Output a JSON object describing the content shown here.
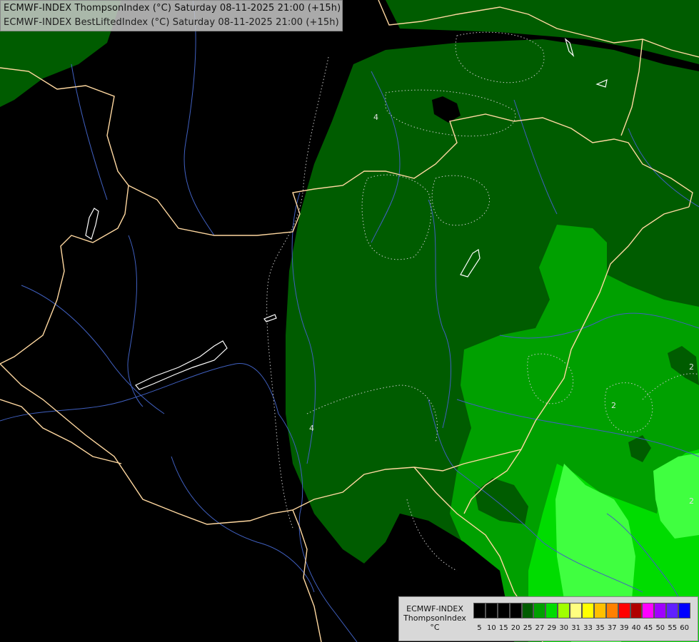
{
  "header": {
    "line1": "ECMWF-INDEX ThompsonIndex (°C) Saturday 08-11-2025 21:00 (+15h)",
    "line2": "ECMWF-INDEX BestLiftedIndex (°C) Saturday 08-11-2025 21:00 (+15h)"
  },
  "legend": {
    "title_line1": "ECMWF-INDEX",
    "title_line2": "ThompsonIndex",
    "title_line3": "°C",
    "values": [
      "5",
      "10",
      "15",
      "20",
      "25",
      "27",
      "29",
      "30",
      "31",
      "33",
      "35",
      "37",
      "39",
      "40",
      "45",
      "50",
      "55",
      "60"
    ],
    "colors": [
      "#000000",
      "#000000",
      "#000000",
      "#000000",
      "#005c00",
      "#00a000",
      "#00dc00",
      "#a0ff00",
      "#ffff80",
      "#ffff00",
      "#ffc000",
      "#ff8000",
      "#ff0000",
      "#b00000",
      "#ff00ff",
      "#a000ff",
      "#6020ff",
      "#0000ff"
    ]
  },
  "map": {
    "contour_labels": [
      "4",
      "4",
      "2",
      "2",
      "2"
    ],
    "colors": {
      "background": "#000000",
      "dark_green": "#005c00",
      "mid_green": "#00a000",
      "bright_green": "#00dc00",
      "lime": "#40ff40",
      "border": "#ffd8a0",
      "river": "#4060c0",
      "contour": "#c8c8c8"
    }
  }
}
